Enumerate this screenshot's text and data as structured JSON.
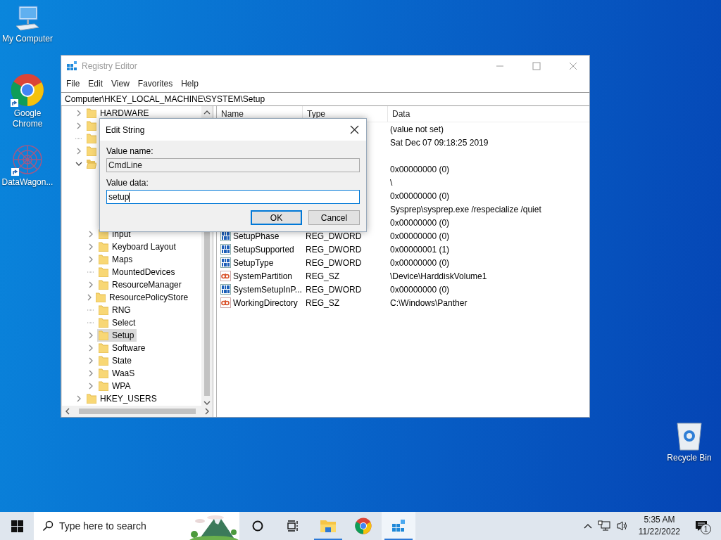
{
  "desktop_icons": [
    {
      "label": "My Computer",
      "kind": "computer",
      "shortcut": false
    },
    {
      "label": "Google Chrome",
      "kind": "browser",
      "shortcut": true
    },
    {
      "label": "DataWagon...",
      "kind": "snowflake",
      "shortcut": true
    },
    {
      "label": "Recycle Bin",
      "kind": "recycle",
      "shortcut": false
    }
  ],
  "window": {
    "title": "Registry Editor",
    "active": false,
    "menu": [
      "File",
      "Edit",
      "View",
      "Favorites",
      "Help"
    ],
    "address": "Computer\\HKEY_LOCAL_MACHINE\\SYSTEM\\Setup",
    "tree": [
      {
        "label": "HARDWARE",
        "expanded": false,
        "selected": false
      },
      {
        "expanded": false,
        "selected": false
      },
      {
        "selected": false
      },
      {
        "expanded": false,
        "selected": false
      },
      {
        "expanded": true,
        "selected": false,
        "children": [
          {
            "label": "Input",
            "expanded": false,
            "selected": false
          },
          {
            "label": "Keyboard Layout",
            "expanded": false,
            "selected": false
          },
          {
            "label": "Maps",
            "expanded": false,
            "selected": false
          },
          {
            "label": "MountedDevices",
            "selected": false
          },
          {
            "label": "ResourceManager",
            "expanded": false,
            "selected": false
          },
          {
            "label": "ResourcePolicyStore",
            "expanded": false,
            "selected": false
          },
          {
            "label": "RNG",
            "selected": false
          },
          {
            "label": "Select",
            "selected": false
          },
          {
            "label": "Setup",
            "expanded": false,
            "selected": true
          },
          {
            "label": "Software",
            "expanded": false,
            "selected": false
          },
          {
            "label": "State",
            "expanded": false,
            "selected": false
          },
          {
            "label": "WaaS",
            "expanded": false,
            "selected": false
          },
          {
            "label": "WPA",
            "expanded": false,
            "selected": false
          }
        ]
      },
      {
        "label": "HKEY_USERS",
        "expanded": false,
        "selected": false
      }
    ],
    "columns": [
      "Name",
      "Type",
      "Data"
    ],
    "values": [
      {
        "data": "(value not set)"
      },
      {
        "data": "Sat Dec 07 09:18:25 2019"
      },
      {
        "kind": "empty"
      },
      {
        "data": "0x00000000 (0)"
      },
      {
        "data": "\\"
      },
      {
        "data": "0x00000000 (0)"
      },
      {
        "data": "Sysprep\\sysprep.exe /respecialize /quiet"
      },
      {
        "data": "0x00000000 (0)"
      },
      {
        "kind": "binary",
        "name": "SetupPhase",
        "type": "REG_DWORD",
        "data": "0x00000000 (0)"
      },
      {
        "kind": "binary",
        "name": "SetupSupported",
        "type": "REG_DWORD",
        "data": "0x00000001 (1)"
      },
      {
        "kind": "binary",
        "name": "SetupType",
        "type": "REG_DWORD",
        "data": "0x00000000 (0)"
      },
      {
        "kind": "string",
        "name": "SystemPartition",
        "type": "REG_SZ",
        "data": "\\Device\\HarddiskVolume1"
      },
      {
        "kind": "binary",
        "name": "SystemSetupInP...",
        "type": "REG_DWORD",
        "data": "0x00000000 (0)"
      },
      {
        "kind": "string",
        "name": "WorkingDirectory",
        "type": "REG_SZ",
        "data": "C:\\Windows\\Panther"
      }
    ]
  },
  "dialog": {
    "title": "Edit String",
    "fields": [
      {
        "label": "Value name:",
        "value": "CmdLine",
        "disabled": true,
        "focused": false
      },
      {
        "label": "Value data:",
        "value": "setup",
        "disabled": false,
        "focused": true
      }
    ],
    "buttons": [
      {
        "label": "OK",
        "default": true
      },
      {
        "label": "Cancel",
        "default": false
      }
    ]
  },
  "taskbar": {
    "search_placeholder": "Type here to search",
    "apps": [
      {
        "kind": "cortana",
        "running": false,
        "selected": false
      },
      {
        "kind": "taskview",
        "running": false,
        "selected": false
      },
      {
        "kind": "explorer",
        "running": true,
        "selected": false
      },
      {
        "kind": "browser",
        "running": false,
        "selected": false
      },
      {
        "kind": "regedit",
        "running": true,
        "selected": true
      }
    ],
    "time": "5:35 AM",
    "date": "11/22/2022",
    "notifications": "1"
  }
}
